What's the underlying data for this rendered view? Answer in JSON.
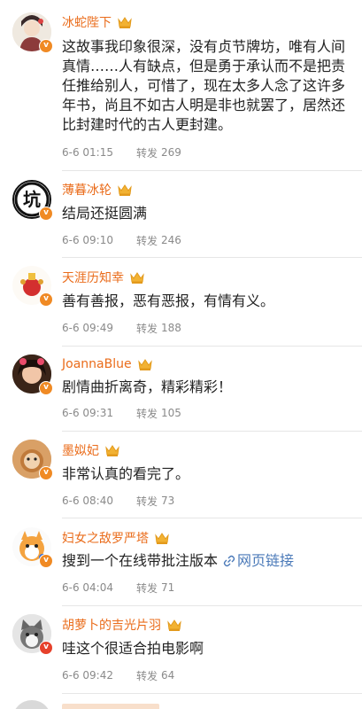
{
  "comments": [
    {
      "username": "冰蛇陛下",
      "text": "这故事我印象很深，没有贞节牌坊，唯有人间真情……人有缺点，但是勇于承认而不是把责任推给别人，可惜了，现在太多人念了这许多年书，尚且不如古人明是非也就罢了，居然还比封建时代的古人更封建。",
      "time": "6-6 01:15",
      "repost_label": "转发",
      "repost_count": "269",
      "badge": "v"
    },
    {
      "username": "薄暮冰轮",
      "text": "结局还挺圆满",
      "time": "6-6 09:10",
      "repost_label": "转发",
      "repost_count": "246",
      "badge": "v"
    },
    {
      "username": "天涯历知幸",
      "text": "善有善报，恶有恶报，有情有义。",
      "time": "6-6 09:49",
      "repost_label": "转发",
      "repost_count": "188",
      "badge": "v"
    },
    {
      "username": "JoannaBlue",
      "text": "剧情曲折离奇，精彩精彩！",
      "time": "6-6 09:31",
      "repost_label": "转发",
      "repost_count": "105",
      "badge": "v"
    },
    {
      "username": "墨姒妃",
      "text": "非常认真的看完了。",
      "time": "6-6 08:40",
      "repost_label": "转发",
      "repost_count": "73",
      "badge": "v"
    },
    {
      "username": "妇女之敌罗严塔",
      "text": "搜到一个在线带批注版本",
      "link_text": "网页链接",
      "time": "6-6 04:04",
      "repost_label": "转发",
      "repost_count": "71",
      "badge": "v"
    },
    {
      "username": "胡萝卜的吉光片羽",
      "text": "哇这个很适合拍电影啊",
      "time": "6-6 09:42",
      "repost_label": "转发",
      "repost_count": "64",
      "badge": "v"
    }
  ],
  "colors": {
    "username": "#ea6c1b",
    "meta": "#8a8a8a",
    "link": "#4a79b8",
    "badge_orange": "#f08a24",
    "badge_red": "#e6412b",
    "crown": "#f2b233"
  },
  "icons": {
    "crown": "crown-icon",
    "verified": "verified-badge-icon",
    "link": "link-icon"
  }
}
